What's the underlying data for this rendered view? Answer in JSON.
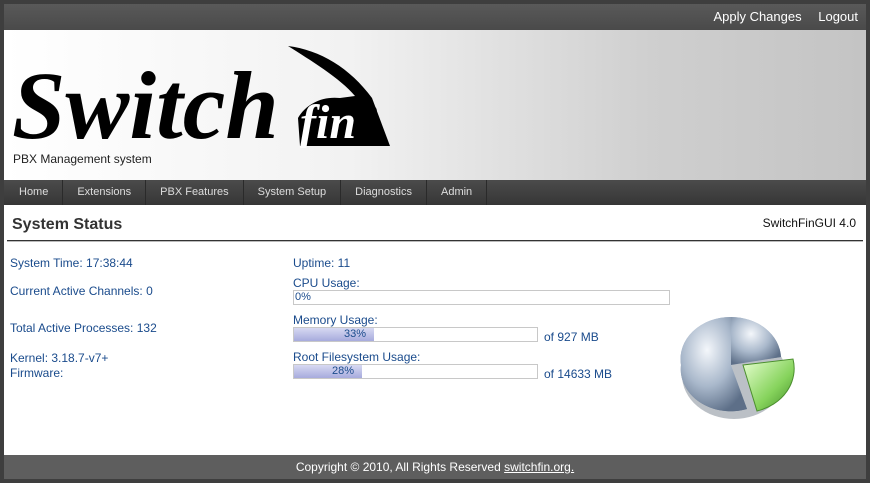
{
  "topbar": {
    "apply_changes": "Apply Changes",
    "logout": "Logout"
  },
  "header": {
    "logo_text": "Switch",
    "logo_fin": "fin",
    "registered": "®",
    "subtitle": "PBX Management system"
  },
  "nav": [
    "Home",
    "Extensions",
    "PBX Features",
    "System Setup",
    "Diagnostics",
    "Admin"
  ],
  "main": {
    "title": "System Status",
    "version": "SwitchFinGUI 4.0",
    "system_time": "System Time: 17:38:44",
    "active_channels": "Current Active Channels: 0",
    "active_processes": "Total Active Processes: 132",
    "kernel": "Kernel: 3.18.7-v7+",
    "firmware": "Firmware:",
    "uptime": "Uptime: 11",
    "cpu": {
      "label": "CPU Usage:",
      "value": 0,
      "text": "0%"
    },
    "memory": {
      "label": "Memory Usage:",
      "value": 33,
      "text": "33%",
      "suffix": "of 927 MB"
    },
    "rootfs": {
      "label": "Root Filesystem Usage:",
      "value": 28,
      "text": "28%",
      "suffix": "of 14633 MB"
    },
    "pie_icon": "pie-chart-icon"
  },
  "footer": {
    "copyright": "Copyright © 2010, All Rights Reserved",
    "link": "switchfin.org."
  }
}
